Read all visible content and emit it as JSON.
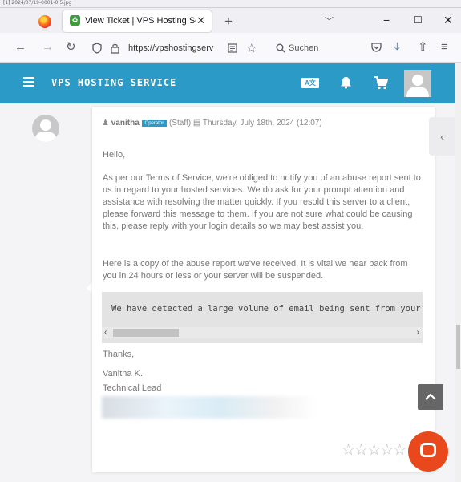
{
  "file_caption": "[1] 2024/07/19-0001-0.5.jpg",
  "browser": {
    "tab_title": "View Ticket | VPS Hosting Servic",
    "tab_close": "✕",
    "new_tab": "+",
    "tab_list": "﹀",
    "minimize": "−",
    "maximize": "☐",
    "close": "✕",
    "url": "https://vpshostingserv",
    "search_placeholder": "Suchen"
  },
  "site": {
    "brand": "VPS HOSTING SERVICE",
    "lang_label": "A文",
    "accent_color": "#2b9ac6"
  },
  "ticket": {
    "author": "vanitha",
    "role_badge": "Operator",
    "meta_rest": "(Staff) ▤ Thursday, July 18th, 2024 (12:07)",
    "greeting": "Hello,",
    "para1": "As per our Terms of Service, we're obliged to notify you of an abuse report sent to us in regard to your hosted services. We do ask for your prompt attention and assistance with resolving the matter quickly. If you resold this server to a client, please forward this message to them. If you are not sure what could be causing this, please reply with your login details so we may best assist you.",
    "para2": "Here is a copy of the abuse report we've received. It is vital we hear back from you in 24 hours or less or your server will be suspended.",
    "code_excerpt": "We have detected a large volume of email being sent from your server",
    "thanks": "Thanks,",
    "sig_name": "Vanitha K.",
    "sig_title": "Technical Lead",
    "rating_stars": "☆☆☆☆☆"
  }
}
